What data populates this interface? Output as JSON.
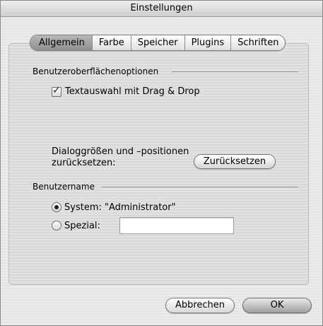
{
  "window": {
    "title": "Einstellungen"
  },
  "tabs": [
    {
      "label": "Allgemein",
      "selected": true
    },
    {
      "label": "Farbe",
      "selected": false
    },
    {
      "label": "Speicher",
      "selected": false
    },
    {
      "label": "Plugins",
      "selected": false
    },
    {
      "label": "Schriften",
      "selected": false
    }
  ],
  "ui_options": {
    "section_label": "Benutzeroberflächenoptionen",
    "drag_drop": {
      "label": "Textauswahl mit Drag & Drop",
      "checked": true
    },
    "reset_label_line1": "Dialoggrößen und –positionen",
    "reset_label_line2": "zurücksetzen:",
    "reset_button": "Zurücksetzen"
  },
  "username": {
    "section_label": "Benutzername",
    "system_label": "System: \"Administrator\"",
    "system_selected": true,
    "special_label": "Spezial:",
    "special_selected": false,
    "special_value": ""
  },
  "footer": {
    "cancel_label": "Abbrechen",
    "ok_label": "OK"
  }
}
